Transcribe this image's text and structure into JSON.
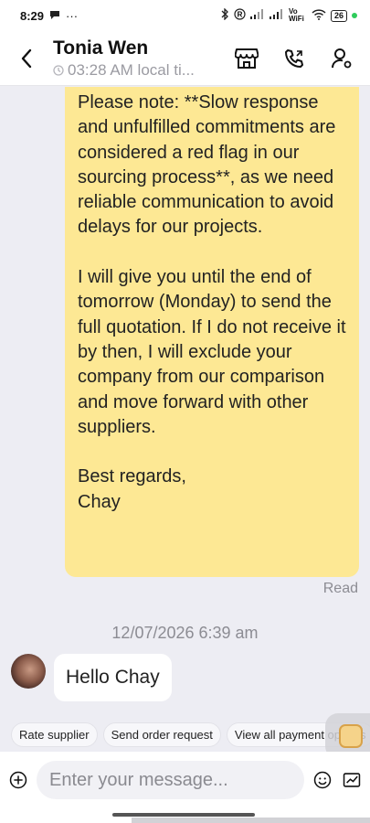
{
  "status_bar": {
    "time": "8:29",
    "dots": "···",
    "volte": "Vo WiFi",
    "battery": "26"
  },
  "header": {
    "contact_name": "Tonia Wen",
    "local_time": "03:28 AM local ti..."
  },
  "messages": {
    "outgoing": {
      "paragraph_1": "Please note: **Slow response and unfulfilled commitments are considered a red flag in our sourcing process**, as we need reliable communication to avoid delays for our projects.",
      "paragraph_2": "I will give you until the end of tomorrow (Monday) to send the full quotation. If I do not receive it by then, I will exclude your company from our comparison and move forward with other suppliers.",
      "closing": "Best regards,",
      "signature": "Chay",
      "status": "Read"
    },
    "timestamp": "12/07/2026 6:39 am",
    "incoming": {
      "text": "Hello Chay"
    }
  },
  "quick_replies": [
    "Rate supplier",
    "Send order request",
    "View all payment options"
  ],
  "composer": {
    "placeholder": "Enter your message..."
  },
  "colors": {
    "outgoing_bubble": "#fde894",
    "chat_background": "#ededf3",
    "online_dot": "#2ecc5b"
  }
}
